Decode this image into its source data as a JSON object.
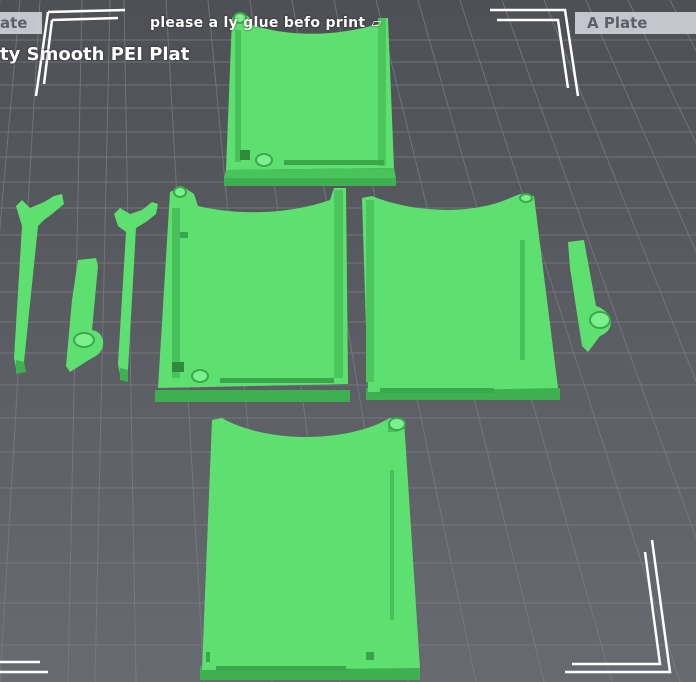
{
  "viewport": {
    "tabs": {
      "left_label": "ate",
      "right_label": "A Plate"
    },
    "notice_text": "please a    ly glue befo    print",
    "plate_type_label": "ty Smooth PEI Plat"
  },
  "icons": {
    "notice_edit": "edit-icon"
  },
  "colors": {
    "background": "#5b5d63",
    "grid_line": "#777a80",
    "part_green": "#5ee070",
    "part_green_dark": "#3fb04f",
    "part_green_light": "#7cf08c",
    "corner_marks": "#ffffff"
  }
}
